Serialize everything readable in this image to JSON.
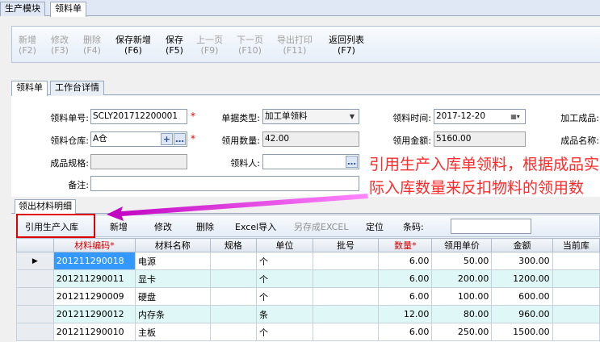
{
  "top_tabs": [
    "生产模块",
    "领料单"
  ],
  "toolbar": [
    {
      "label": "新增",
      "key": "(F2)",
      "enabled": false
    },
    {
      "label": "修改",
      "key": "(F3)",
      "enabled": false
    },
    {
      "label": "删除",
      "key": "(F4)",
      "enabled": false
    },
    {
      "label": "保存新增",
      "key": "(F6)",
      "enabled": true
    },
    {
      "label": "保存",
      "key": "(F5)",
      "enabled": true
    },
    {
      "label": "上一页",
      "key": "(F9)",
      "enabled": false
    },
    {
      "label": "下一页",
      "key": "(F10)",
      "enabled": false
    },
    {
      "label": "导出打印",
      "key": "(F11)",
      "enabled": false
    },
    {
      "label": "返回列表",
      "key": "(F7)",
      "enabled": true
    }
  ],
  "sub_tabs": [
    "领料单",
    "工作台详情"
  ],
  "form": {
    "order_no_label": "领料单号:",
    "order_no": "SCLY201712200001",
    "doc_type_label": "单据类型:",
    "doc_type": "加工单领料",
    "pick_time_label": "领料时间:",
    "pick_time": "2017-12-20",
    "product_label": "加工成品:",
    "warehouse_label": "领料仓库:",
    "warehouse": "A仓",
    "qty_label": "领用数量:",
    "qty": "42.00",
    "amount_label": "领用金额:",
    "amount": "5160.00",
    "product_name_label": "成品名称:",
    "spec_label": "成品规格:",
    "picker_label": "领料人:",
    "remark_label": "备注:",
    "required_mark": "*"
  },
  "annotation": "引用生产入库单领料，根据成品实际入库数量来反扣物料的领用数",
  "detail_tab": "领出材料明细",
  "grid_toolbar": {
    "ref_production": "引用生产入库",
    "add": "新增",
    "edit": "修改",
    "delete": "删除",
    "excel_import": "Excel导入",
    "save_as_excel": "另存成EXCEL",
    "locate": "定位",
    "barcode_label": "条码:"
  },
  "columns": [
    "材料编码*",
    "材料名称",
    "规格",
    "单位",
    "批号",
    "数量*",
    "领用单价",
    "金额",
    "当前库"
  ],
  "rows": [
    {
      "code": "201211290018",
      "name": "电源",
      "spec": "",
      "unit": "个",
      "batch": "",
      "qty": "6.00",
      "price": "50.00",
      "amount": "300.00",
      "stock": ""
    },
    {
      "code": "201211290011",
      "name": "显卡",
      "spec": "",
      "unit": "个",
      "batch": "",
      "qty": "6.00",
      "price": "200.00",
      "amount": "1200.00",
      "stock": ""
    },
    {
      "code": "201211290009",
      "name": "硬盘",
      "spec": "",
      "unit": "个",
      "batch": "",
      "qty": "6.00",
      "price": "100.00",
      "amount": "600.00",
      "stock": ""
    },
    {
      "code": "201211290012",
      "name": "内存条",
      "spec": "",
      "unit": "条",
      "batch": "",
      "qty": "12.00",
      "price": "80.00",
      "amount": "960.00",
      "stock": ""
    },
    {
      "code": "201211290010",
      "name": "主板",
      "spec": "",
      "unit": "个",
      "batch": "",
      "qty": "6.00",
      "price": "250.00",
      "amount": "1500.00",
      "stock": ""
    }
  ],
  "colors": {
    "accent_red": "#ff2a2a",
    "arrow": "#ee33ee",
    "selected": "#3399ff",
    "row_alt": "#dff7f7"
  }
}
